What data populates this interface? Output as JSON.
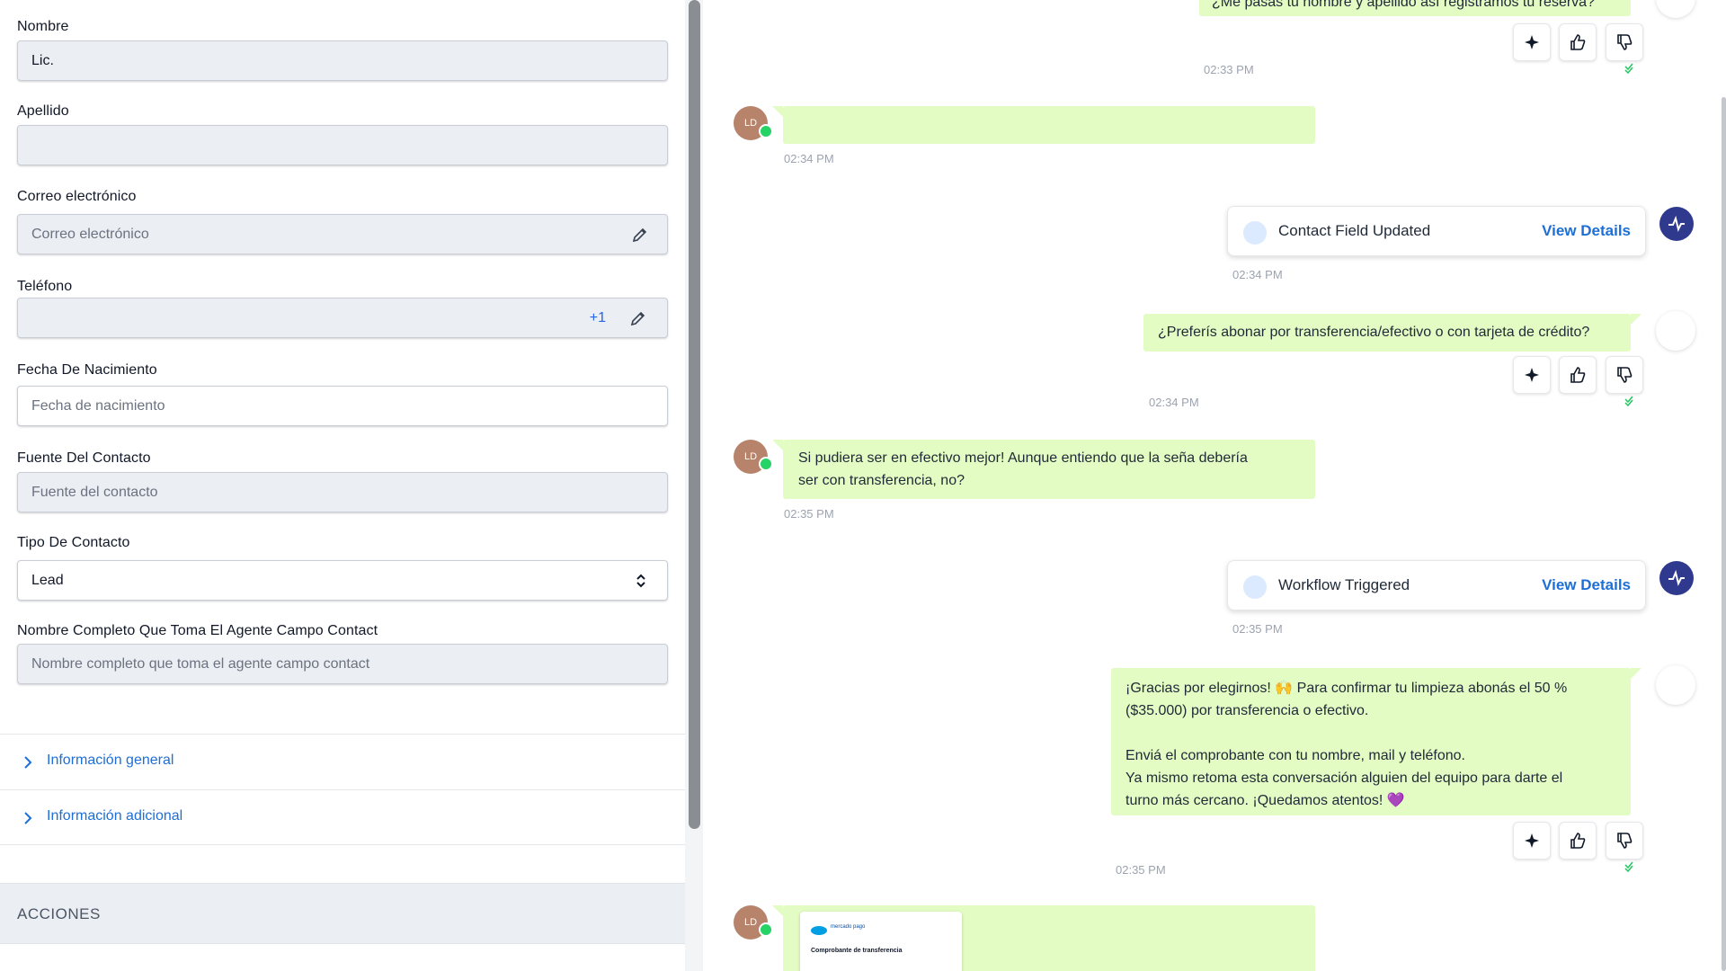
{
  "contact_form": {
    "nombre": {
      "label": "Nombre",
      "value": "Lic."
    },
    "apellido": {
      "label": "Apellido",
      "value": ""
    },
    "correo": {
      "label": "Correo electrónico",
      "placeholder": "Correo electrónico"
    },
    "telefono": {
      "label": "Teléfono",
      "value": "",
      "country_code": "+1"
    },
    "fecha_nacimiento": {
      "label": "Fecha De Nacimiento",
      "placeholder": "Fecha de nacimiento"
    },
    "fuente": {
      "label": "Fuente Del Contacto",
      "placeholder": "Fuente del contacto"
    },
    "tipo": {
      "label": "Tipo De Contacto",
      "value": "Lead"
    },
    "nombre_completo": {
      "label": "Nombre Completo Que Toma El Agente Campo Contact",
      "placeholder": "Nombre completo que toma el agente campo contact"
    }
  },
  "sections": {
    "general": "Información general",
    "adicional": "Información adicional",
    "acciones": "ACCIONES"
  },
  "chat": {
    "top_partial_text": "¿Me pasás tu nombre y apellido así registramos tu reserva?",
    "messages": [
      {
        "direction": "in",
        "avatar": "LD",
        "text": "",
        "time": "02:34 PM"
      },
      {
        "direction": "out",
        "text": "¿Preferís abonar por transferencia/efectivo o con tarjeta de crédito?",
        "time": "02:34 PM"
      },
      {
        "direction": "in",
        "avatar": "LD",
        "text": "Si pudiera ser en efectivo mejor! Aunque entiendo que la seña debería\nser con transferencia, no?",
        "time": "02:35 PM"
      },
      {
        "direction": "out",
        "text": "¡Gracias por elegirnos! 🙌 Para confirmar tu limpieza abonás el 50 %\n($35.000) por transferencia o efectivo.\n\nEnviá el comprobante con tu nombre, mail y teléfono.\nYa mismo retoma esta conversación alguien del equipo para darte el\nturno más cercano. ¡Quedamos atentos! 💜",
        "time": "02:35 PM"
      },
      {
        "direction": "in",
        "avatar": "LD",
        "text": "",
        "time": ""
      }
    ],
    "first_out_time": "02:33 PM",
    "events": [
      {
        "title": "Contact Field Updated",
        "link": "View Details",
        "time": "02:34 PM"
      },
      {
        "title": "Workflow Triggered",
        "link": "View Details",
        "time": "02:35 PM"
      }
    ],
    "receipt": {
      "brand": "mercado pago",
      "title": "Comprobante de transferencia"
    }
  },
  "colors": {
    "bubble": "#e3fcc3",
    "link": "#1d6fd6",
    "activity": "#2f3a8f"
  }
}
